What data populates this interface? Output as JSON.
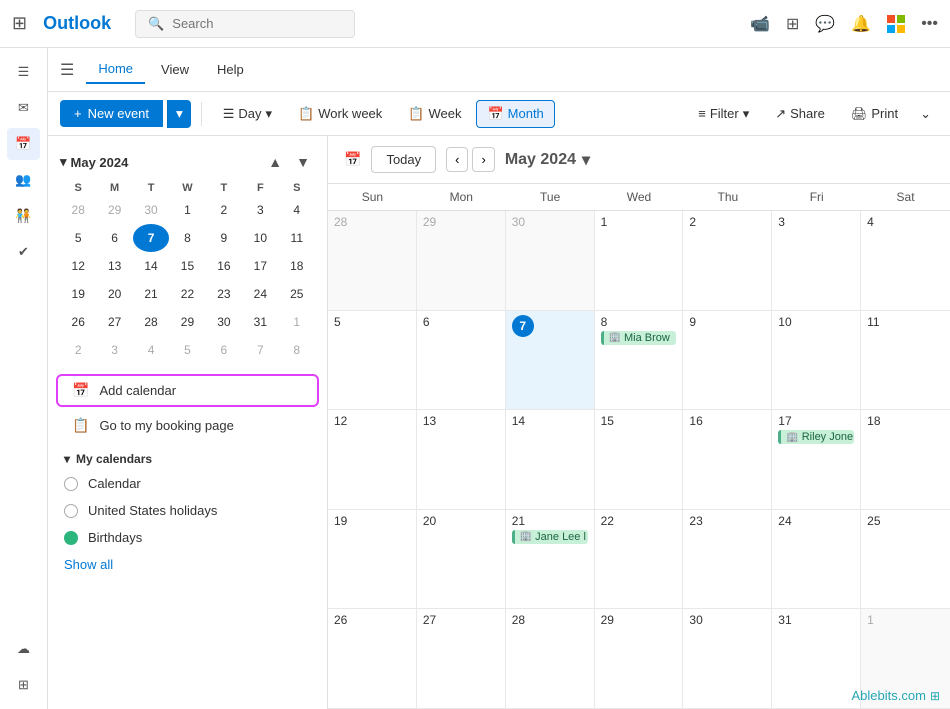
{
  "app": {
    "name": "Outlook"
  },
  "topbar": {
    "search_placeholder": "Search",
    "icons": [
      "video-icon",
      "grid-view-icon",
      "chat-icon",
      "bell-icon",
      "ms-logo-icon",
      "more-icon"
    ]
  },
  "navbar": {
    "hamburger": "☰",
    "tabs": [
      {
        "label": "Home",
        "active": true
      },
      {
        "label": "View",
        "active": false
      },
      {
        "label": "Help",
        "active": false
      }
    ]
  },
  "toolbar": {
    "new_event_label": "New event",
    "view_buttons": [
      {
        "label": "Day",
        "active": false
      },
      {
        "label": "Work week",
        "active": false
      },
      {
        "label": "Week",
        "active": false
      },
      {
        "label": "Month",
        "active": true
      }
    ],
    "filter_label": "Filter",
    "share_label": "Share",
    "print_label": "Print"
  },
  "sidebar": {
    "mini_cal": {
      "title": "May 2024",
      "days_of_week": [
        "S",
        "M",
        "T",
        "W",
        "T",
        "F",
        "S"
      ],
      "weeks": [
        [
          {
            "num": "28",
            "other": true
          },
          {
            "num": "29",
            "other": true
          },
          {
            "num": "30",
            "other": true
          },
          {
            "num": "1"
          },
          {
            "num": "2"
          },
          {
            "num": "3"
          },
          {
            "num": "4"
          }
        ],
        [
          {
            "num": "5"
          },
          {
            "num": "6"
          },
          {
            "num": "7",
            "today": true
          },
          {
            "num": "8"
          },
          {
            "num": "9"
          },
          {
            "num": "10"
          },
          {
            "num": "11"
          }
        ],
        [
          {
            "num": "12"
          },
          {
            "num": "13"
          },
          {
            "num": "14"
          },
          {
            "num": "15"
          },
          {
            "num": "16"
          },
          {
            "num": "17"
          },
          {
            "num": "18"
          }
        ],
        [
          {
            "num": "19"
          },
          {
            "num": "20"
          },
          {
            "num": "21"
          },
          {
            "num": "22"
          },
          {
            "num": "23"
          },
          {
            "num": "24"
          },
          {
            "num": "25"
          }
        ],
        [
          {
            "num": "26"
          },
          {
            "num": "27"
          },
          {
            "num": "28"
          },
          {
            "num": "29"
          },
          {
            "num": "30"
          },
          {
            "num": "31"
          },
          {
            "num": "1",
            "other": true
          }
        ],
        [
          {
            "num": "2",
            "other": true
          },
          {
            "num": "3",
            "other": true
          },
          {
            "num": "4",
            "other": true
          },
          {
            "num": "5",
            "other": true
          },
          {
            "num": "6",
            "other": true
          },
          {
            "num": "7",
            "other": true
          },
          {
            "num": "8",
            "other": true
          }
        ]
      ]
    },
    "add_calendar_label": "Add calendar",
    "booking_page_label": "Go to my booking page",
    "my_calendars_label": "My calendars",
    "calendars": [
      {
        "name": "Calendar",
        "color": "none",
        "checked": false
      },
      {
        "name": "United States holidays",
        "color": "none",
        "checked": false
      },
      {
        "name": "Birthdays",
        "color": "#2cb67d",
        "checked": true
      }
    ],
    "show_all_label": "Show all"
  },
  "calendar": {
    "today_label": "Today",
    "month_title": "May 2024",
    "days_of_week": [
      "Sun",
      "Mon",
      "Tue",
      "Wed",
      "Thu",
      "Fri",
      "Sat"
    ],
    "weeks": [
      [
        {
          "num": "28",
          "other": true
        },
        {
          "num": "29",
          "other": true
        },
        {
          "num": "30",
          "other": true
        },
        {
          "num": "1"
        },
        {
          "num": "2"
        },
        {
          "num": "3"
        },
        {
          "num": "4"
        }
      ],
      [
        {
          "num": "5"
        },
        {
          "num": "6"
        },
        {
          "num": "7",
          "today": true
        },
        {
          "num": "8",
          "events": [
            {
              "label": "Mia Brow",
              "icon": "🏢"
            }
          ]
        },
        {
          "num": "9"
        },
        {
          "num": "10"
        },
        {
          "num": "11"
        }
      ],
      [
        {
          "num": "12"
        },
        {
          "num": "13"
        },
        {
          "num": "14"
        },
        {
          "num": "15"
        },
        {
          "num": "16"
        },
        {
          "num": "17",
          "events": [
            {
              "label": "Riley Jone",
              "icon": "🏢"
            }
          ]
        },
        {
          "num": "18"
        }
      ],
      [
        {
          "num": "19"
        },
        {
          "num": "20"
        },
        {
          "num": "21",
          "events": [
            {
              "label": "Jane Lee l",
              "icon": "🏢"
            }
          ]
        },
        {
          "num": "22"
        },
        {
          "num": "23"
        },
        {
          "num": "24"
        },
        {
          "num": "25"
        }
      ],
      [
        {
          "num": "26"
        },
        {
          "num": "27"
        },
        {
          "num": "28"
        },
        {
          "num": "29"
        },
        {
          "num": "30"
        },
        {
          "num": "31"
        },
        {
          "num": "1",
          "other": true
        }
      ]
    ]
  },
  "watermark": {
    "text": "Ablebits.com"
  }
}
